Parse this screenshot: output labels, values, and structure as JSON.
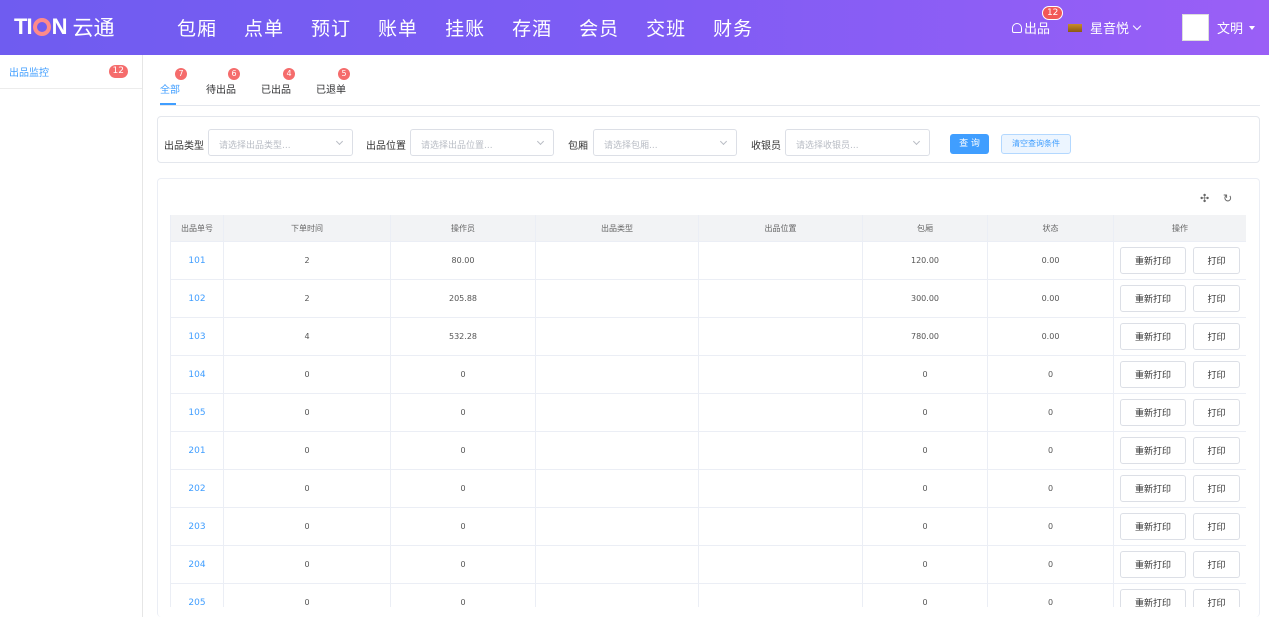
{
  "brand": {
    "logo_text": "TIAN",
    "name": "云通"
  },
  "nav": [
    "包厢",
    "点单",
    "预订",
    "账单",
    "挂账",
    "存酒",
    "会员",
    "交班",
    "财务"
  ],
  "header": {
    "out_label": "出品",
    "out_badge": "12",
    "store_name": "星音悦",
    "user_name": "文明"
  },
  "sidebar": {
    "items": [
      {
        "label": "出品监控",
        "badge": "12"
      }
    ]
  },
  "tabs": [
    {
      "label": "全部",
      "badge": "7",
      "active": true
    },
    {
      "label": "待出品",
      "badge": "6"
    },
    {
      "label": "已出品",
      "badge": "4"
    },
    {
      "label": "已退单",
      "badge": "5"
    }
  ],
  "filters": [
    {
      "label": "出品类型",
      "placeholder": "请选择出品类型..."
    },
    {
      "label": "出品位置",
      "placeholder": "请选择出品位置..."
    },
    {
      "label": "包厢",
      "placeholder": "请选择包厢..."
    },
    {
      "label": "收银员",
      "placeholder": "请选择收银员..."
    }
  ],
  "buttons": {
    "query": "查 询",
    "clear": "清空查询条件"
  },
  "toolbar": {
    "move_icon": "move-icon",
    "refresh_icon": "refresh-icon"
  },
  "table": {
    "headers": [
      "出品单号",
      "下单时间",
      "操作员",
      "出品类型",
      "出品位置",
      "包厢",
      "状态",
      "操作"
    ],
    "action_labels": {
      "reprint": "重新打印",
      "print": "打印"
    },
    "rows": [
      {
        "id": "101",
        "time": "2",
        "operator": "80.00",
        "type": "",
        "location": "",
        "room": "120.00",
        "status": "0.00"
      },
      {
        "id": "102",
        "time": "2",
        "operator": "205.88",
        "type": "",
        "location": "",
        "room": "300.00",
        "status": "0.00"
      },
      {
        "id": "103",
        "time": "4",
        "operator": "532.28",
        "type": "",
        "location": "",
        "room": "780.00",
        "status": "0.00"
      },
      {
        "id": "104",
        "time": "0",
        "operator": "0",
        "type": "",
        "location": "",
        "room": "0",
        "status": "0"
      },
      {
        "id": "105",
        "time": "0",
        "operator": "0",
        "type": "",
        "location": "",
        "room": "0",
        "status": "0"
      },
      {
        "id": "201",
        "time": "0",
        "operator": "0",
        "type": "",
        "location": "",
        "room": "0",
        "status": "0"
      },
      {
        "id": "202",
        "time": "0",
        "operator": "0",
        "type": "",
        "location": "",
        "room": "0",
        "status": "0"
      },
      {
        "id": "203",
        "time": "0",
        "operator": "0",
        "type": "",
        "location": "",
        "room": "0",
        "status": "0"
      },
      {
        "id": "204",
        "time": "0",
        "operator": "0",
        "type": "",
        "location": "",
        "room": "0",
        "status": "0"
      },
      {
        "id": "205",
        "time": "0",
        "operator": "0",
        "type": "",
        "location": "",
        "room": "0",
        "status": "0"
      }
    ]
  }
}
